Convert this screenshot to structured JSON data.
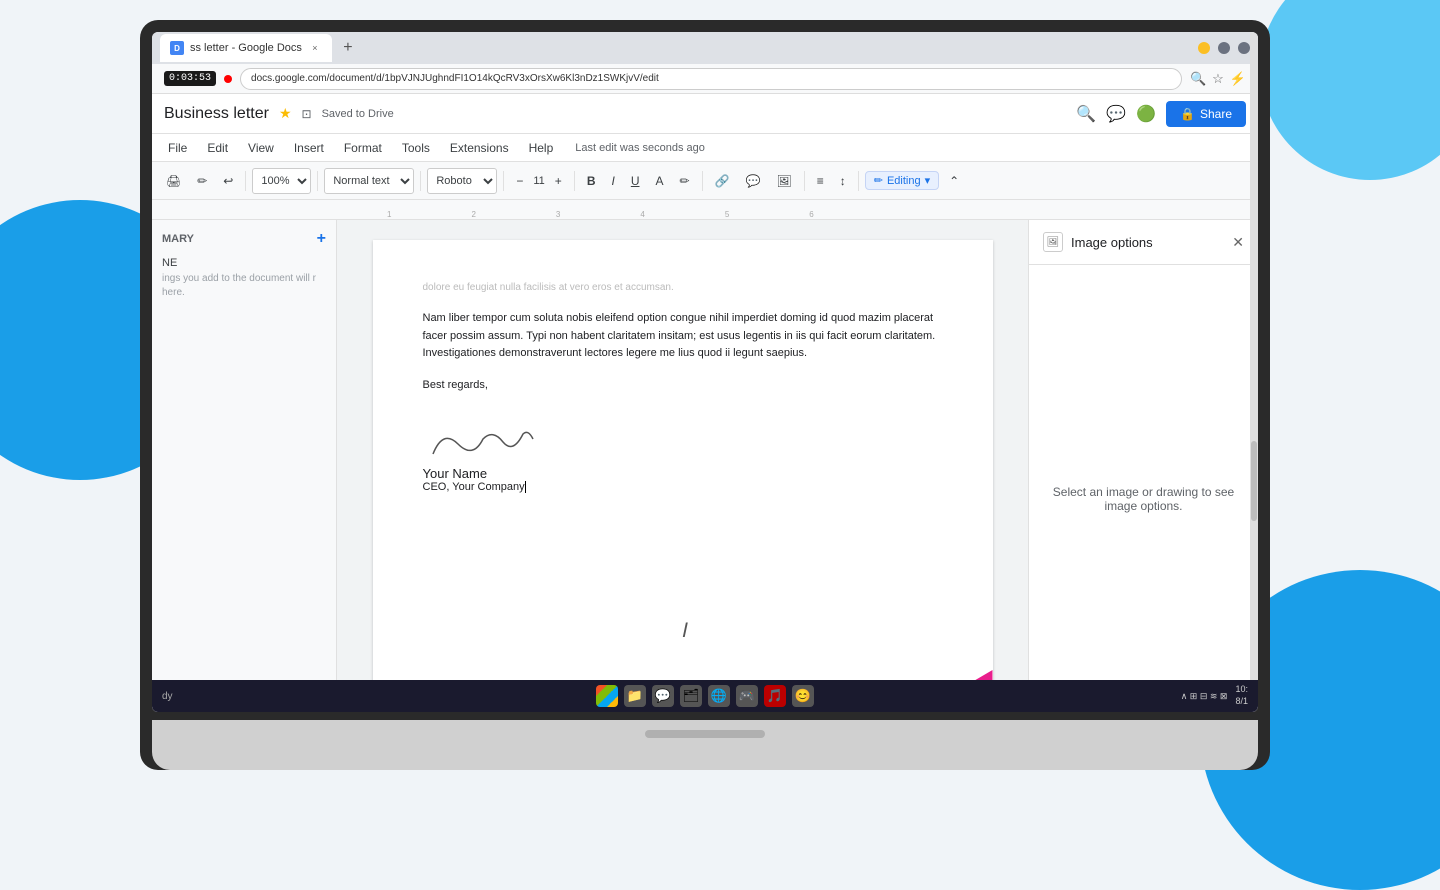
{
  "background": {
    "color": "#f0f4f8"
  },
  "browser": {
    "tab_title": "ss letter - Google Docs",
    "tab_close_label": "×",
    "new_tab_label": "+",
    "address": "docs.google.com/document/d/1bpVJNJUghndFI1O14kQcRV3xOrsXw6Kl3nDz1SWKjvV/edit",
    "timer": "0:03:53",
    "window_controls": [
      "−",
      "□",
      "×"
    ]
  },
  "docs": {
    "title": "Business letter",
    "star_label": "★",
    "drive_icon": "⊡",
    "saved_status": "Saved to Drive",
    "last_edit": "Last edit was seconds ago",
    "menu_items": [
      "File",
      "Edit",
      "View",
      "Insert",
      "Format",
      "Tools",
      "Extensions",
      "Help"
    ],
    "share_button": "Share",
    "toolbar": {
      "print": "🖨",
      "paint_format": "⌨",
      "undo": "↩",
      "zoom": "100%",
      "style_select": "Normal text",
      "font_select": "Roboto",
      "font_size_minus": "−",
      "font_size": "11",
      "font_size_plus": "+",
      "bold": "B",
      "italic": "I",
      "underline": "U",
      "text_color": "A",
      "highlight": "✏",
      "link": "🔗",
      "comment": "💬",
      "image": "🖼",
      "align": "≡",
      "line_spacing": "↕",
      "editing_label": "Editing",
      "expand": "⌄"
    }
  },
  "sidebar": {
    "outline_label": "MARY",
    "add_label": "+",
    "no_headings_label": "NE",
    "empty_msg": "ings you add to the document will\nr here."
  },
  "document": {
    "content": [
      "dolore eu feugiat nulla facilisis at vero eros et accumsan.",
      "Nam liber tempor cum soluta nobis eleifend option congue nihil imperdiet doming id quod mazim placerat facer possim assum. Typi non habent claritatem insitam; est usus legentis in iis qui facit eorum claritatem. Investigationes demonstraverunt lectores legere me lius quod ii legunt saepius.",
      "Best regards,"
    ],
    "signature_text": "Your Name",
    "signature_title": "CEO, Your Company",
    "cursor_visible": true
  },
  "image_options_panel": {
    "title": "Image options",
    "empty_message": "Select an image or drawing to see image options."
  },
  "taskbar": {
    "left_label": "dy",
    "icons": [
      "⊞",
      "▣",
      "💬",
      "📁",
      "🌐",
      "🎮",
      "🎵",
      "😊"
    ],
    "time": "10:",
    "date": "8/1"
  }
}
